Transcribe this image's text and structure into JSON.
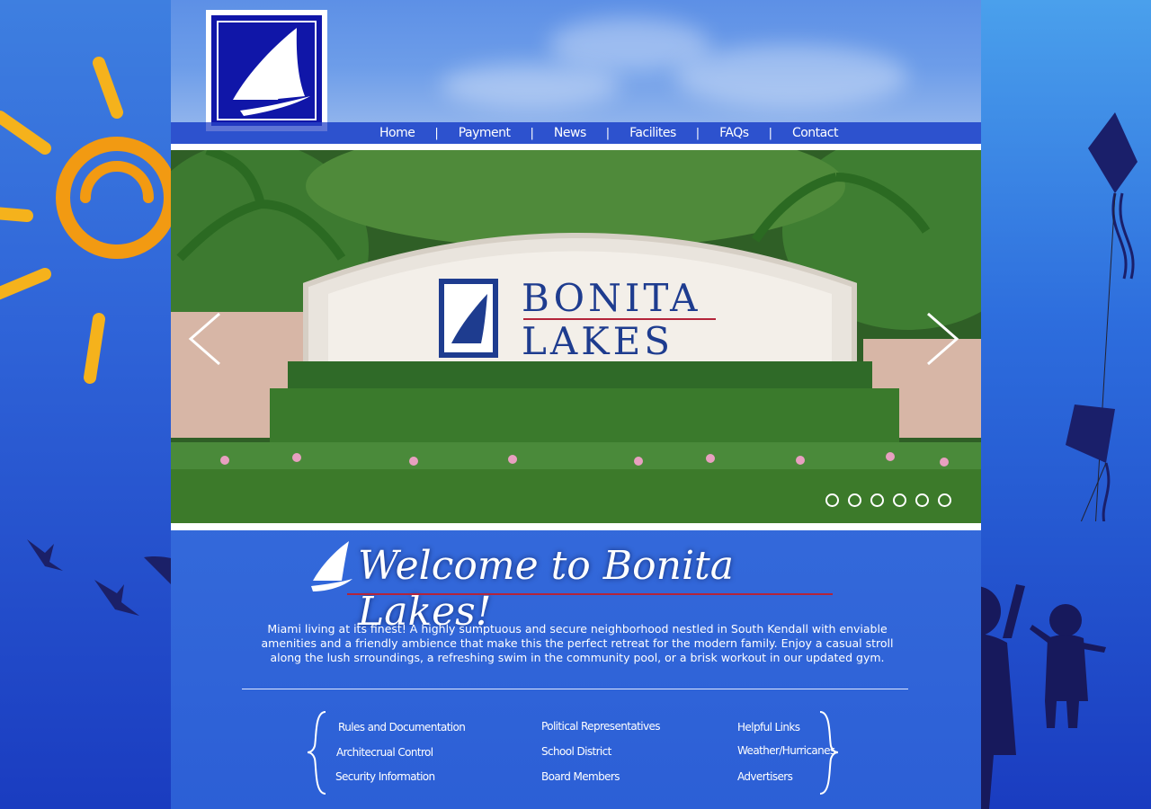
{
  "nav": {
    "items": [
      "Home",
      "Payment",
      "News",
      "Facilites",
      "FAQs",
      "Contact"
    ],
    "separator": "|"
  },
  "hero": {
    "sign_line1": "BONITA",
    "sign_line2": "LAKES",
    "slide_count": 6,
    "active_slide": 1
  },
  "welcome": {
    "title": "Welcome to Bonita Lakes!",
    "intro": "Miami living at its finest!  A highly sumptuous and secure neighborhood nestled in South Kendall with enviable amenities and a friendly ambience that make this the perfect retreat for the modern family. Enjoy a casual stroll along the lush srroundings, a refreshing swim in the community pool, or a brisk workout in our updated gym."
  },
  "links": {
    "col1": [
      "Rules and Documentation",
      "Architecrual Control",
      "Security Information"
    ],
    "col2": [
      "Political Representatives",
      "School District",
      "Board Members"
    ],
    "col3": [
      "Helpful Links",
      "Weather/Hurricanes",
      "Advertisers"
    ]
  },
  "colors": {
    "brand_navy": "#1016a8",
    "accent_red": "#b3243a",
    "background_blue": "#2a5fd8"
  },
  "icons": {
    "logo": "sailboat-logo-icon",
    "prev": "chevron-left-icon",
    "next": "chevron-right-icon"
  }
}
